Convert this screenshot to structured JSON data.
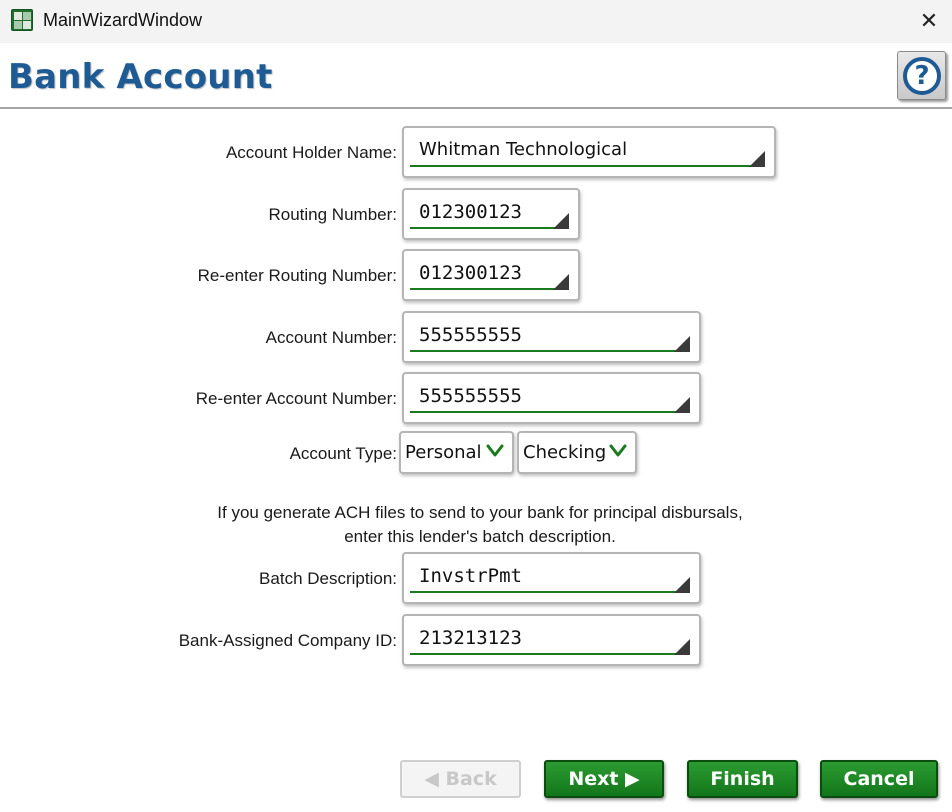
{
  "window": {
    "title": "MainWizardWindow",
    "close_glyph": "✕",
    "icon": "spreadsheet-app-icon"
  },
  "header": {
    "title": "Bank Account",
    "help_glyph": "?"
  },
  "form": {
    "account_holder_name": {
      "label": "Account Holder Name:",
      "value": "Whitman Technological"
    },
    "routing_number": {
      "label": "Routing Number:",
      "value": "012300123"
    },
    "reenter_routing_number": {
      "label": "Re-enter Routing Number:",
      "value": "012300123"
    },
    "account_number": {
      "label": "Account Number:",
      "value": "555555555"
    },
    "reenter_account_number": {
      "label": "Re-enter Account Number:",
      "value": "555555555"
    },
    "account_type": {
      "label": "Account Type:",
      "ownership": "Personal",
      "kind": "Checking"
    },
    "ach_note_line1": "If you generate ACH files to send to your bank for principal disbursals,",
    "ach_note_line2": "enter this lender's batch description.",
    "batch_description": {
      "label": "Batch Description:",
      "value": "InvstrPmt"
    },
    "company_id": {
      "label": "Bank-Assigned Company ID:",
      "value": "213213123"
    }
  },
  "buttons": {
    "back": "◀ Back",
    "next": "Next ▶",
    "finish": "Finish",
    "cancel": "Cancel"
  },
  "colors": {
    "accent_title": "#1e5a94",
    "field_underline": "#197a1e",
    "button_green": "#13761a"
  }
}
